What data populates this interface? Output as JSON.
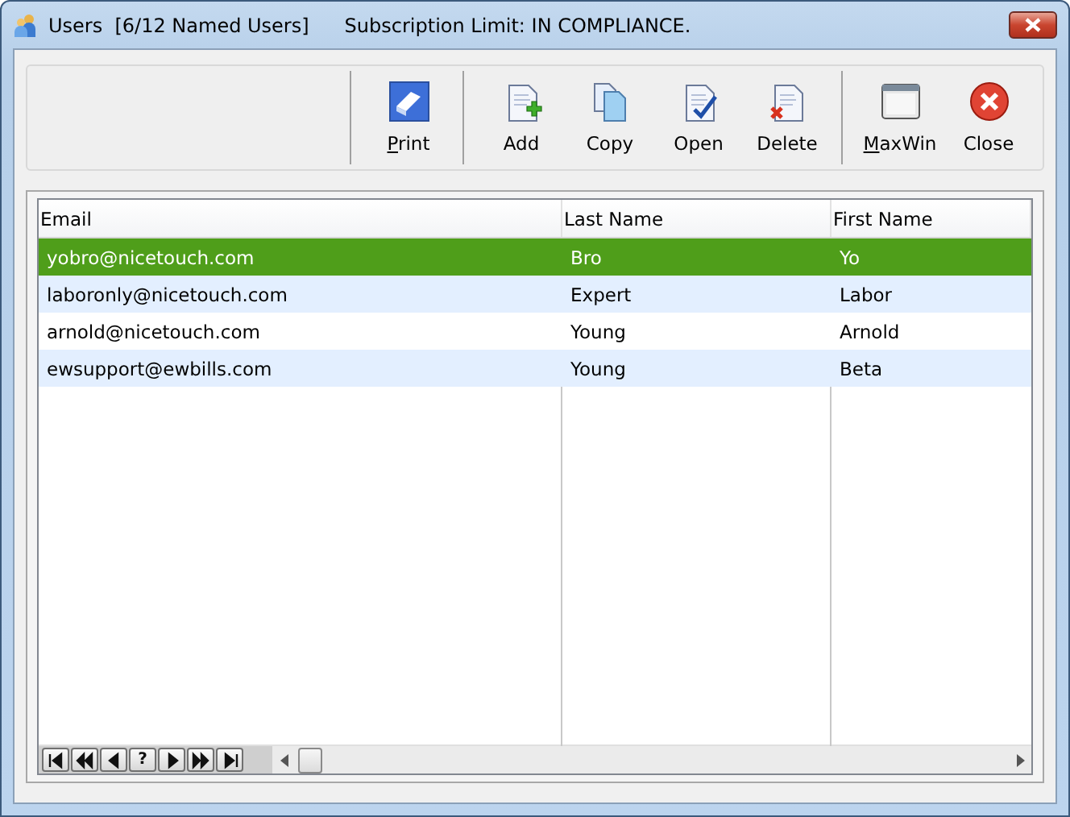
{
  "window": {
    "title": "Users  [6/12 Named Users]",
    "subtitle": "Subscription Limit: IN COMPLIANCE."
  },
  "toolbar": {
    "groups": [
      [
        {
          "kind": "print",
          "label": "Print",
          "mnemonic": true
        }
      ],
      [
        {
          "kind": "add",
          "label": "Add",
          "mnemonic": false
        },
        {
          "kind": "copy",
          "label": "Copy",
          "mnemonic": false
        },
        {
          "kind": "open",
          "label": "Open",
          "mnemonic": false
        },
        {
          "kind": "delete",
          "label": "Delete",
          "mnemonic": false
        }
      ],
      [
        {
          "kind": "maxwin",
          "label": "MaxWin",
          "mnemonic": true
        },
        {
          "kind": "close",
          "label": "Close",
          "mnemonic": false
        }
      ]
    ]
  },
  "table": {
    "columns": [
      "Email",
      "Last Name",
      "First Name"
    ],
    "rows": [
      {
        "cells": [
          "yobro@nicetouch.com",
          "Bro",
          "Yo"
        ],
        "selected": true
      },
      {
        "cells": [
          "laboronly@nicetouch.com",
          "Expert",
          "Labor"
        ],
        "selected": false
      },
      {
        "cells": [
          "arnold@nicetouch.com",
          "Young",
          "Arnold"
        ],
        "selected": false
      },
      {
        "cells": [
          "ewsupport@ewbills.com",
          "Young",
          "Beta"
        ],
        "selected": false
      }
    ]
  },
  "navigator": [
    {
      "kind": "first"
    },
    {
      "kind": "prev_page"
    },
    {
      "kind": "prev"
    },
    {
      "kind": "help",
      "text": "?"
    },
    {
      "kind": "next"
    },
    {
      "kind": "next_page"
    },
    {
      "kind": "last"
    }
  ]
}
